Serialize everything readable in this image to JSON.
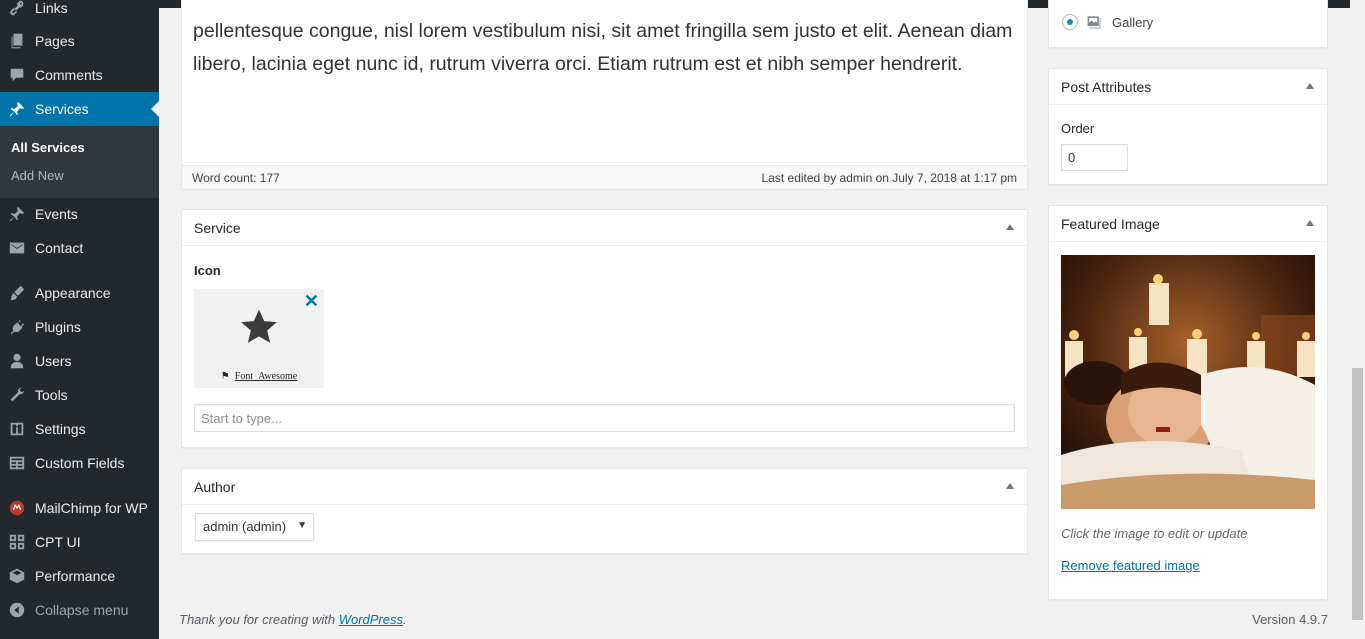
{
  "sidebar": {
    "items": [
      {
        "label": "Links",
        "icon": "links-icon"
      },
      {
        "label": "Pages",
        "icon": "pages-icon"
      },
      {
        "label": "Comments",
        "icon": "comments-icon"
      },
      {
        "label": "Services",
        "icon": "pin-icon",
        "active": true
      },
      {
        "label": "Events",
        "icon": "pin-icon"
      },
      {
        "label": "Contact",
        "icon": "mail-icon"
      },
      {
        "label": "Appearance",
        "icon": "brush-icon"
      },
      {
        "label": "Plugins",
        "icon": "plug-icon"
      },
      {
        "label": "Users",
        "icon": "user-icon"
      },
      {
        "label": "Tools",
        "icon": "wrench-icon"
      },
      {
        "label": "Settings",
        "icon": "settings-icon"
      },
      {
        "label": "Custom Fields",
        "icon": "custom-fields-icon"
      },
      {
        "label": "MailChimp for WP",
        "icon": "mailchimp-icon"
      },
      {
        "label": "CPT UI",
        "icon": "grid-icon"
      },
      {
        "label": "Performance",
        "icon": "cube-icon"
      },
      {
        "label": "Collapse menu",
        "icon": "collapse-icon"
      }
    ],
    "submenu": [
      {
        "label": "All Services",
        "current": true
      },
      {
        "label": "Add New"
      }
    ]
  },
  "editor": {
    "content": "pellentesque congue, nisl lorem vestibulum nisi, sit amet fringilla sem justo et elit. Aenean diam libero, lacinia eget nunc id, rutrum viverra orci. Etiam rutrum est et nibh semper hendrerit.",
    "word_count": "Word count: 177",
    "last_edited": "Last edited by admin on July 7, 2018 at 1:17 pm"
  },
  "service_box": {
    "title": "Service",
    "icon_label": "Icon",
    "icon_source": "Font_Awesome",
    "remove_symbol": "✕",
    "search_placeholder": "Start to type..."
  },
  "author_box": {
    "title": "Author",
    "selected": "admin (admin)"
  },
  "format": {
    "gallery_label": "Gallery"
  },
  "post_attributes": {
    "title": "Post Attributes",
    "order_label": "Order",
    "order_value": "0"
  },
  "featured_image": {
    "title": "Featured Image",
    "note": "Click the image to edit or update",
    "remove_link": "Remove featured image"
  },
  "footer": {
    "thanks_prefix": "Thank you for creating with ",
    "wordpress_link": "WordPress",
    "thanks_suffix": ".",
    "version": "Version 4.9.7"
  },
  "colors": {
    "sidebar_bg": "#23282d",
    "active_blue": "#0073aa",
    "page_bg": "#f1f1f1"
  }
}
